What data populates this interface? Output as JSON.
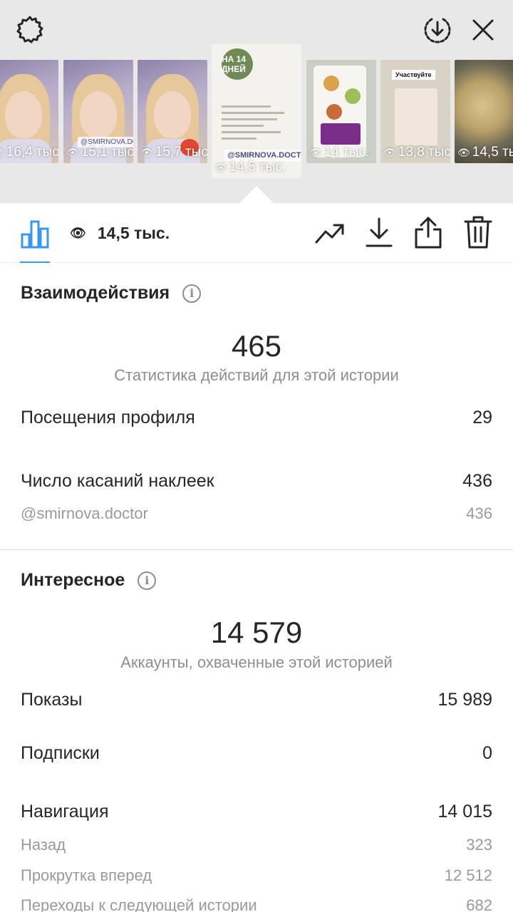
{
  "header": {
    "settings_icon": "gear-icon",
    "download_icon": "download-circle-icon",
    "close_icon": "close-icon"
  },
  "stories": [
    {
      "views": "16,4 тыс."
    },
    {
      "views": "15,1 тыс."
    },
    {
      "views": "15,7 тыс."
    },
    {
      "views": "14,5 тыс.",
      "sticker": "@SMIRNOVA.DOCTOR",
      "badge": "НА 14 ДНЕЙ"
    },
    {
      "views": "14 тыс."
    },
    {
      "views": "13,8 тыс.",
      "label": "Участвуйте"
    },
    {
      "views": "14,5 тыс."
    }
  ],
  "toolbar": {
    "views": "14,5 тыс.",
    "icons": [
      "bar-chart-icon",
      "eye-icon",
      "trending-icon",
      "download-icon",
      "share-icon",
      "trash-icon"
    ],
    "accent_color": "#3897f0"
  },
  "interactions": {
    "title": "Взаимодействия",
    "total": "465",
    "caption": "Статистика действий для этой истории",
    "rows": [
      {
        "label": "Посещения профиля",
        "value": "29"
      },
      {
        "label": "Число касаний наклеек",
        "value": "436"
      }
    ],
    "sub_rows": [
      {
        "label": "@smirnova.doctor",
        "value": "436"
      }
    ]
  },
  "discovery": {
    "title": "Интересное",
    "total": "14 579",
    "caption": "Аккаунты, охваченные этой историей",
    "rows": [
      {
        "label": "Показы",
        "value": "15 989"
      },
      {
        "label": "Подписки",
        "value": "0"
      },
      {
        "label": "Навигация",
        "value": "14 015"
      }
    ],
    "sub_rows": [
      {
        "label": "Назад",
        "value": "323"
      },
      {
        "label": "Прокрутка вперед",
        "value": "12 512"
      },
      {
        "label": "Переходы к следующей истории",
        "value": "682"
      }
    ]
  }
}
